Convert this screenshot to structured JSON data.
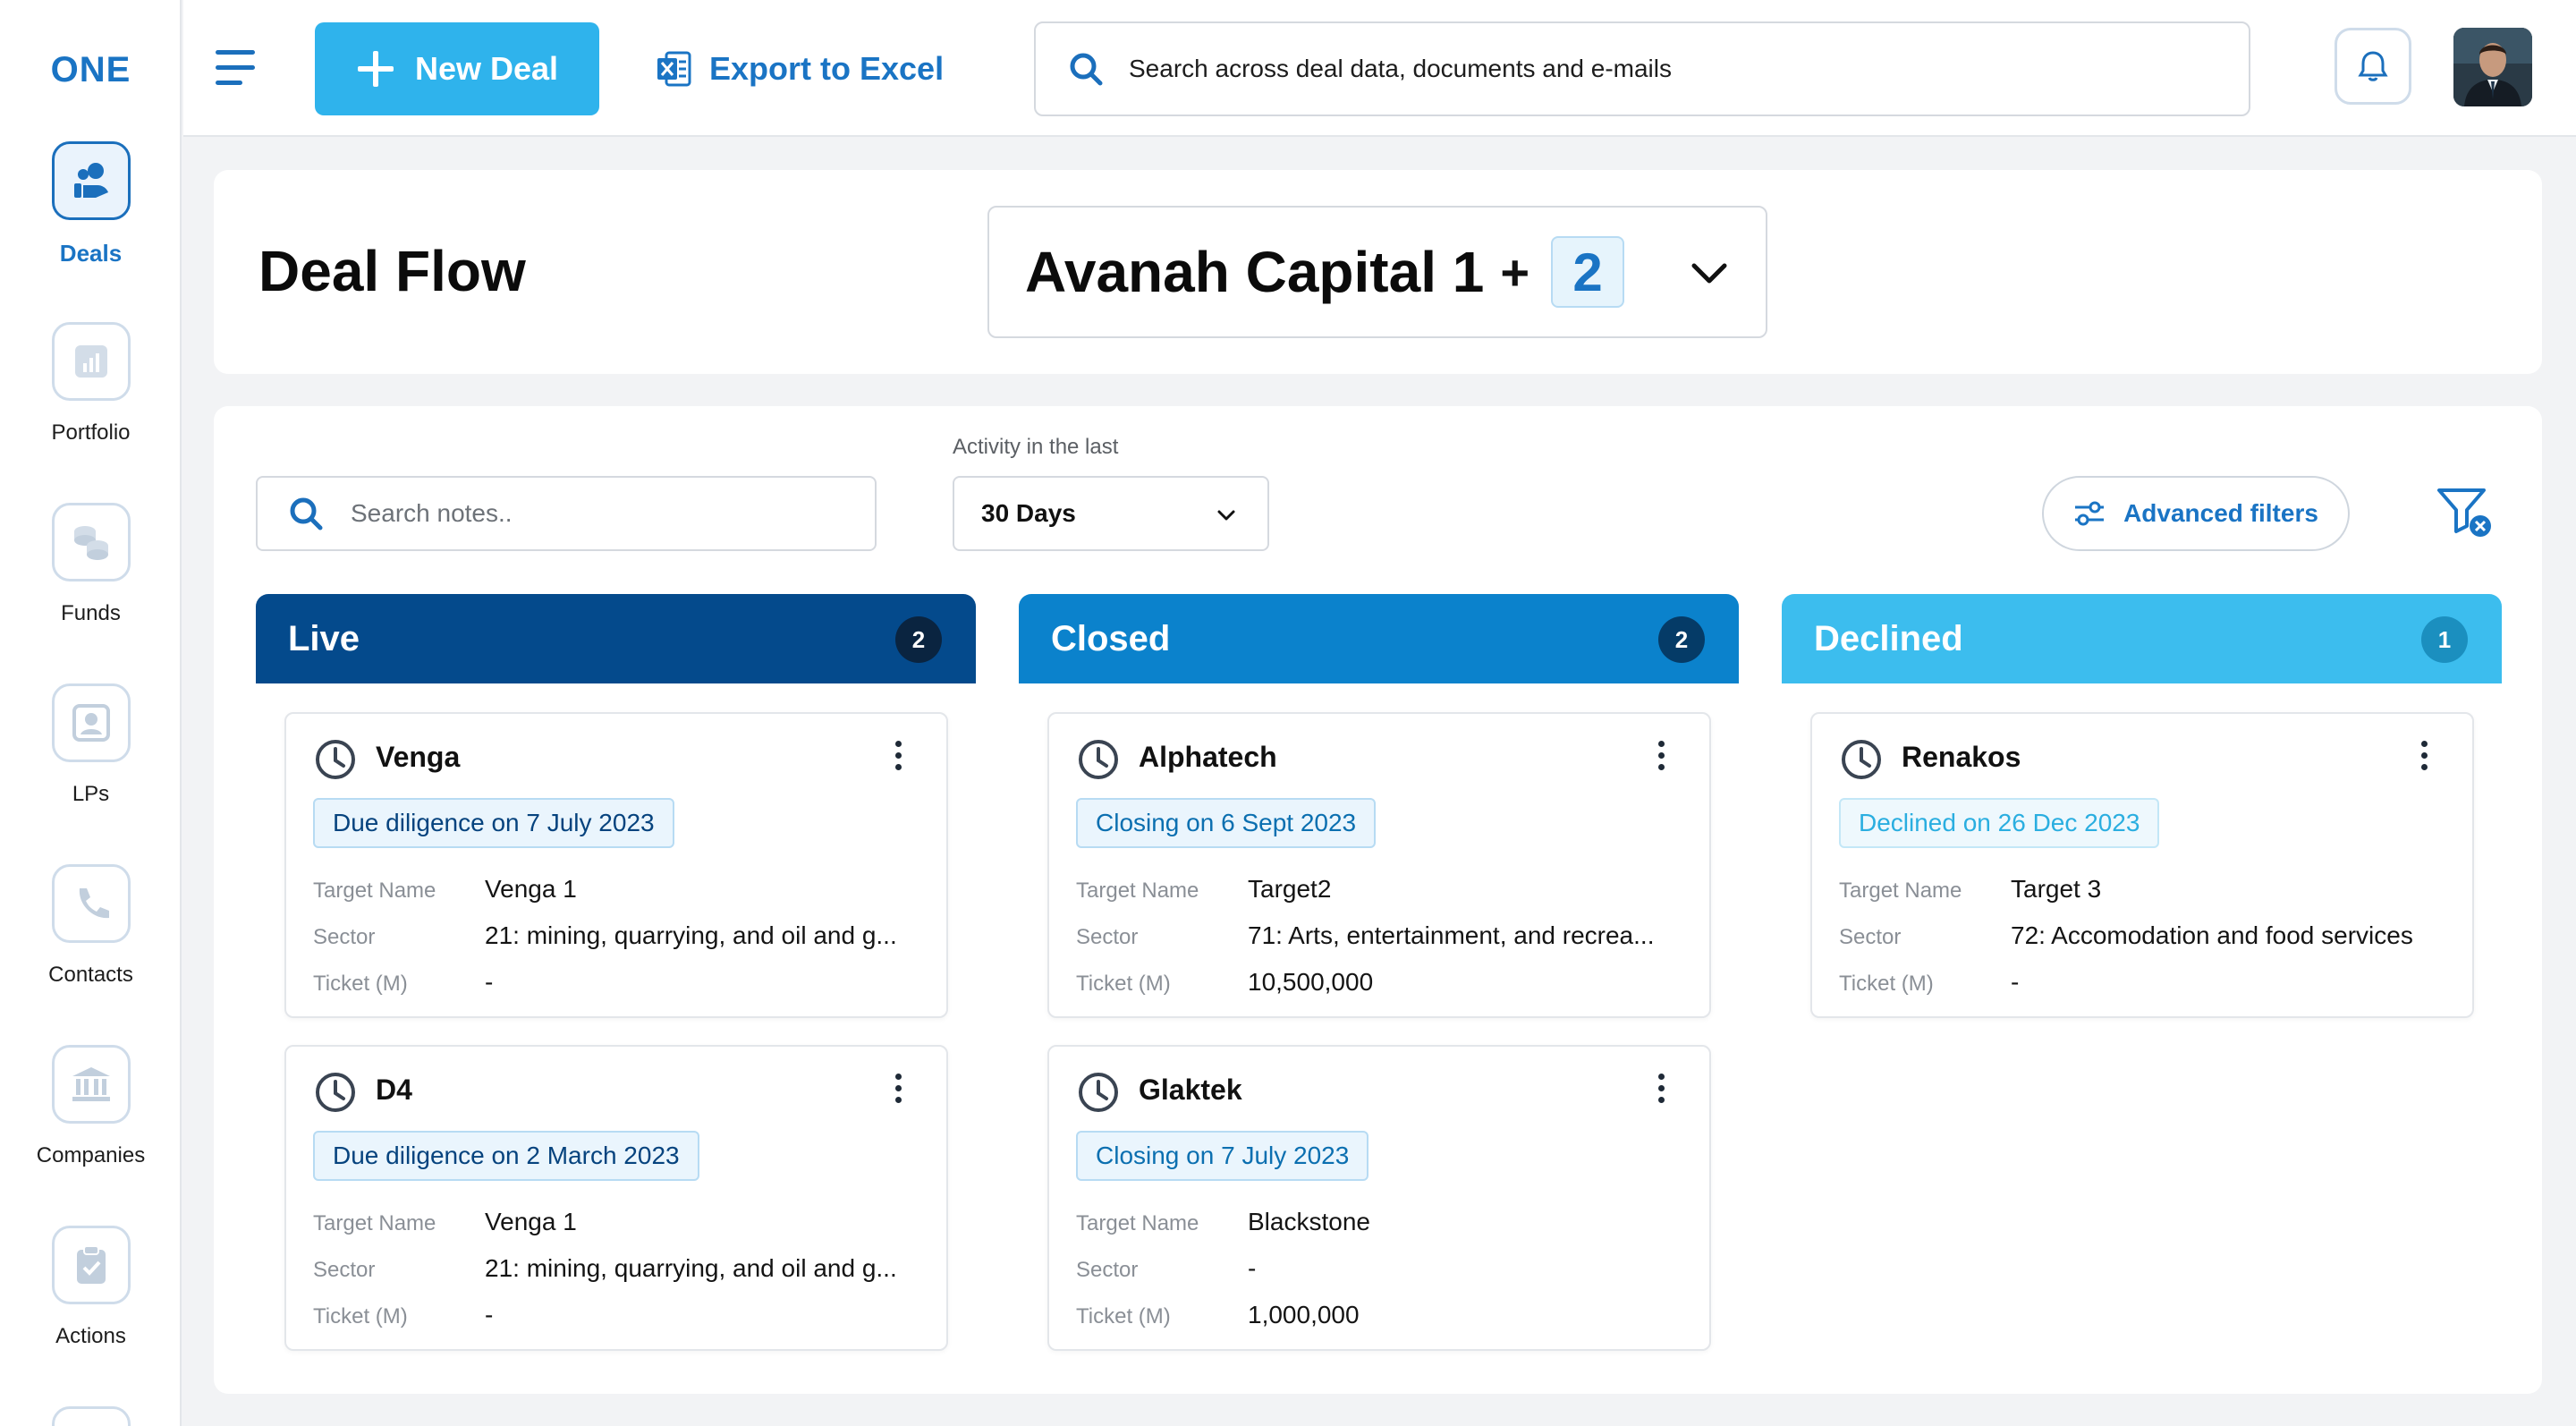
{
  "sidebar": {
    "logo": "ONE",
    "items": [
      {
        "label": "Deals",
        "icon": "deals-icon",
        "active": true
      },
      {
        "label": "Portfolio",
        "icon": "portfolio-chart-icon"
      },
      {
        "label": "Funds",
        "icon": "funds-coins-icon"
      },
      {
        "label": "LPs",
        "icon": "lps-person-icon"
      },
      {
        "label": "Contacts",
        "icon": "phone-icon"
      },
      {
        "label": "Companies",
        "icon": "bank-icon"
      },
      {
        "label": "Actions",
        "icon": "clipboard-check-icon"
      }
    ]
  },
  "topbar": {
    "new_deal_label": "New Deal",
    "export_label": "Export to Excel",
    "search_placeholder": "Search across deal data, documents and e-mails"
  },
  "header": {
    "title": "Deal Flow",
    "fund_name": "Avanah Capital 1",
    "fund_plus": "+",
    "fund_extra_count": "2"
  },
  "filters": {
    "notes_placeholder": "Search notes..",
    "activity_label": "Activity in the last",
    "activity_value": "30 Days",
    "advanced_label": "Advanced filters"
  },
  "labels": {
    "target_name": "Target Name",
    "sector": "Sector",
    "ticket": "Ticket (M)"
  },
  "colors": {
    "live": "#044a8c",
    "closed": "#0b82cc",
    "declined": "#3cbdee",
    "accent": "#1a74c4",
    "new_deal_bg": "#2fb3ec"
  },
  "columns": [
    {
      "title": "Live",
      "count": "2",
      "deals": [
        {
          "name": "Venga",
          "status": "Due diligence",
          "on": "on 7 July 2023",
          "target": "Venga 1",
          "sector": "21: mining, quarrying, and oil and g...",
          "ticket": "-"
        },
        {
          "name": "D4",
          "status": "Due diligence",
          "on": "on 2 March 2023",
          "target": "Venga 1",
          "sector": "21: mining, quarrying, and oil and g...",
          "ticket": "-"
        }
      ]
    },
    {
      "title": "Closed",
      "count": "2",
      "deals": [
        {
          "name": "Alphatech",
          "status": "Closing",
          "on": "on 6 Sept 2023",
          "target": "Target2",
          "sector": "71: Arts, entertainment, and recrea...",
          "ticket": "10,500,000"
        },
        {
          "name": "Glaktek",
          "status": "Closing",
          "on": "on 7 July 2023",
          "target": "Blackstone",
          "sector": "-",
          "ticket": "1,000,000"
        }
      ]
    },
    {
      "title": "Declined",
      "count": "1",
      "deals": [
        {
          "name": "Renakos",
          "status": "Declined",
          "on": "on 26 Dec 2023",
          "target": "Target 3",
          "sector": "72: Accomodation and food services",
          "ticket": "-"
        }
      ]
    }
  ]
}
